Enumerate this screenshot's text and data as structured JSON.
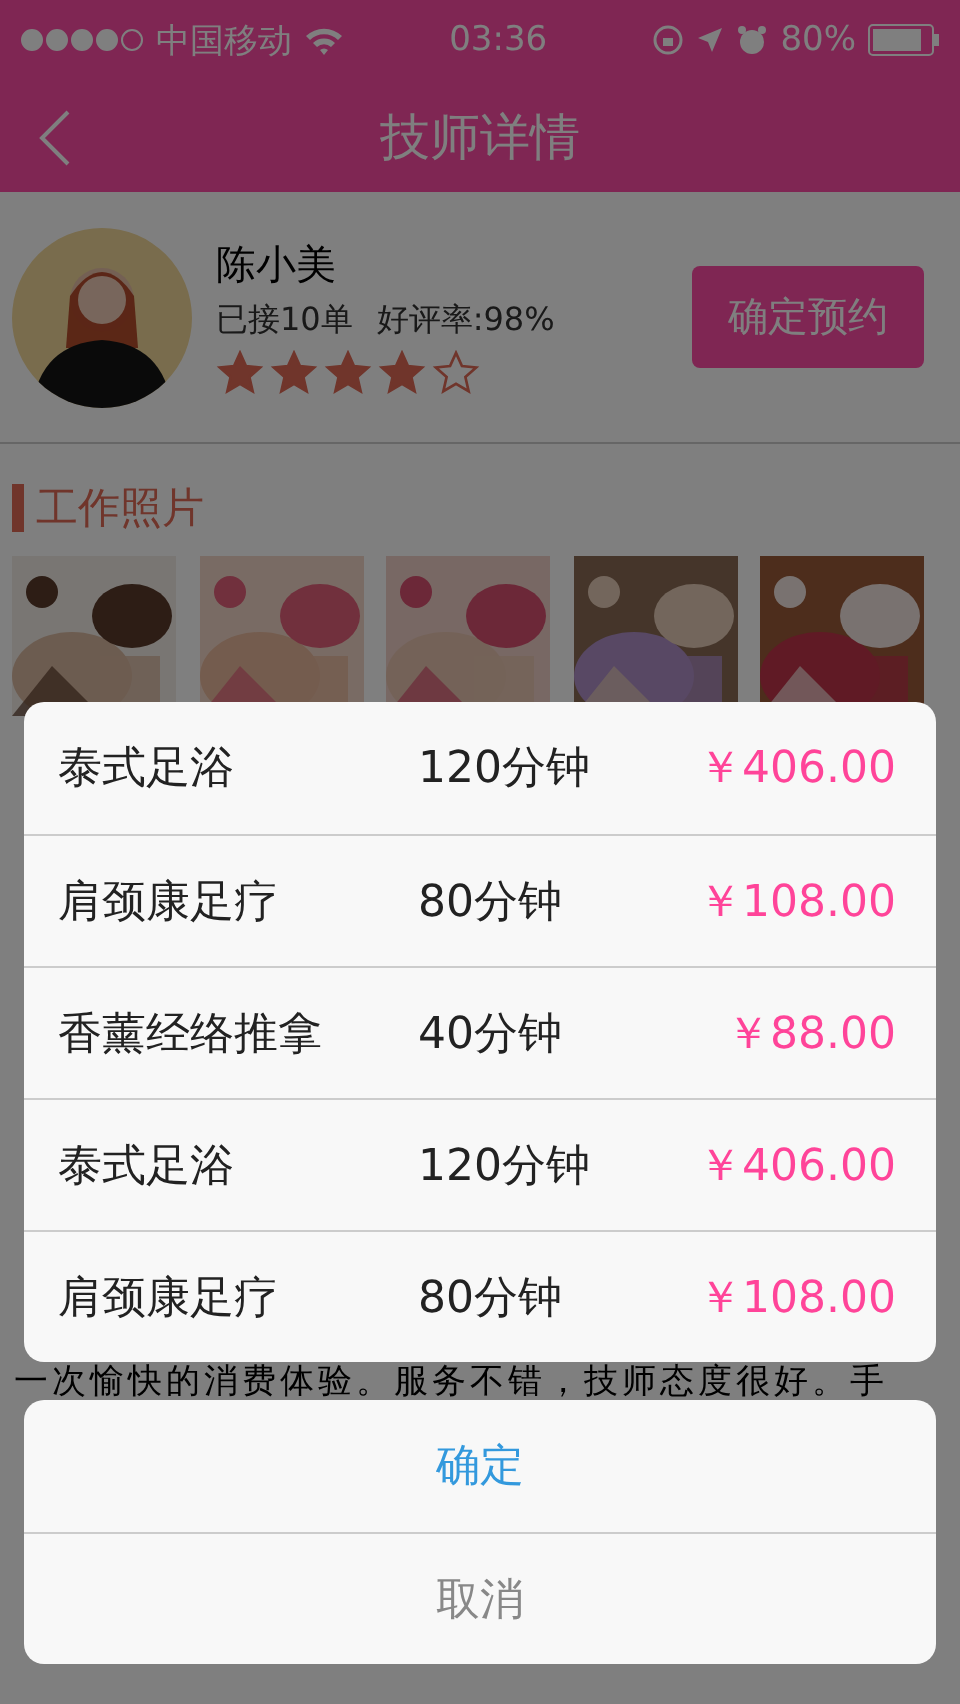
{
  "status_bar": {
    "carrier": "中国移动",
    "time": "03:36",
    "battery": "80%"
  },
  "nav": {
    "title": "技师详情"
  },
  "technician": {
    "name": "陈小美",
    "orders": "已接10单",
    "rating": "好评率:98%",
    "stars": 4,
    "book_button": "确定预约"
  },
  "photos_section": {
    "title": "工作照片"
  },
  "comment": "一次愉快的消费体验。服务不错，技师态度很好。手",
  "service_sheet": {
    "items": [
      {
        "name": "泰式足浴",
        "duration": "120分钟",
        "price": "￥406.00"
      },
      {
        "name": "肩颈康足疗",
        "duration": "80分钟",
        "price": "￥108.00"
      },
      {
        "name": "香薰经络推拿",
        "duration": "40分钟",
        "price": "￥88.00"
      },
      {
        "name": "泰式足浴",
        "duration": "120分钟",
        "price": "￥406.00"
      },
      {
        "name": "肩颈康足疗",
        "duration": "80分钟",
        "price": "￥108.00"
      }
    ],
    "confirm": "确定",
    "cancel": "取消"
  }
}
